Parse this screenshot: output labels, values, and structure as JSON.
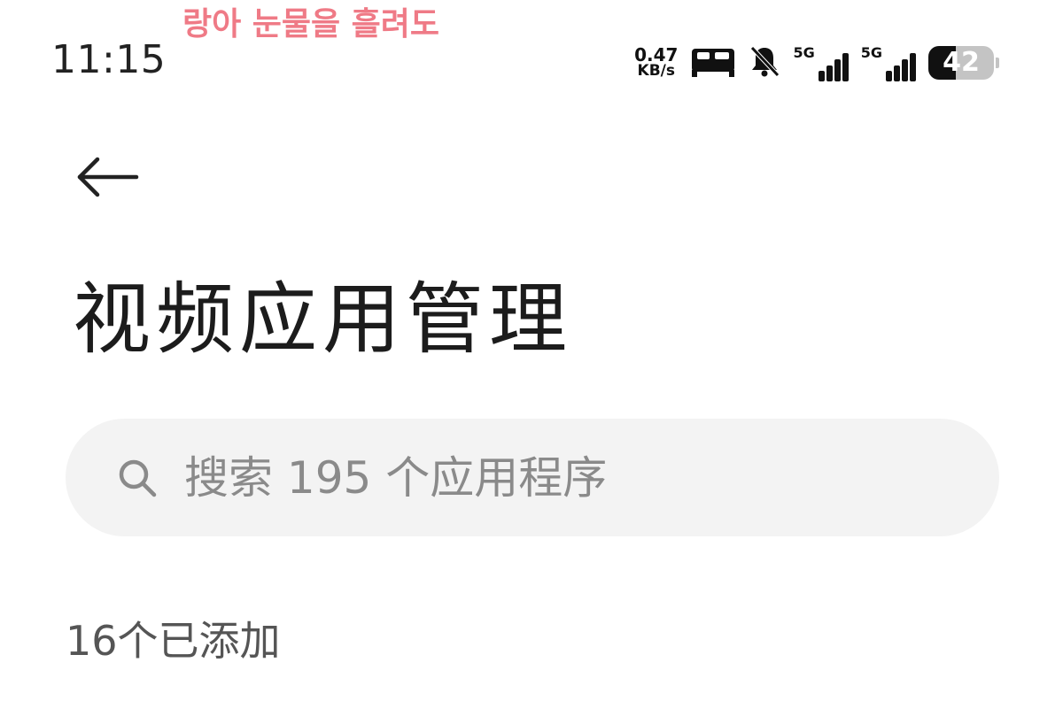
{
  "status_bar": {
    "time": "11:15",
    "lyric": "랑아 눈물을 흘려도",
    "net_speed_value": "0.47",
    "net_speed_unit": "KB/s",
    "sim1_tag": "5G",
    "sim2_tag": "5G",
    "battery_level": "42",
    "icons": [
      "bed-icon",
      "bell-muted-icon",
      "signal-icon",
      "signal-icon",
      "battery-icon"
    ]
  },
  "header": {
    "back_icon": "arrow-left-icon",
    "title": "视频应用管理"
  },
  "search": {
    "placeholder": "搜索 195 个应用程序",
    "value": "",
    "icon": "search-icon"
  },
  "section": {
    "added_label": "16个已添加"
  },
  "colors": {
    "background": "#ffffff",
    "search_bg": "#f3f3f3",
    "lyric": "#ef7a86",
    "placeholder": "#8a8a8a"
  }
}
